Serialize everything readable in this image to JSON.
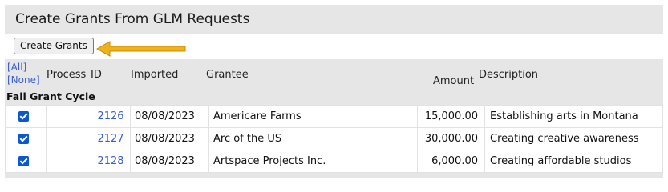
{
  "page": {
    "title": "Create Grants From GLM Requests"
  },
  "toolbar": {
    "create_label": "Create Grants"
  },
  "columns": {
    "all": "[All]",
    "none": "[None]",
    "process": "Process",
    "id": "ID",
    "imported": "Imported",
    "grantee": "Grantee",
    "amount": "Amount",
    "description": "Description"
  },
  "section": {
    "title": "Fall Grant Cycle"
  },
  "rows": [
    {
      "checked": true,
      "id": "2126",
      "imported": "08/08/2023",
      "grantee": "Americare Farms",
      "amount": "15,000.00",
      "description": "Establishing arts in Montana"
    },
    {
      "checked": true,
      "id": "2127",
      "imported": "08/08/2023",
      "grantee": "Arc of the US",
      "amount": "30,000.00",
      "description": "Creating creative awareness"
    },
    {
      "checked": true,
      "id": "2128",
      "imported": "08/08/2023",
      "grantee": "Artspace Projects Inc.",
      "amount": "6,000.00",
      "description": "Creating affordable studios"
    }
  ],
  "colors": {
    "header_bg": "#e6e6e6",
    "link": "#3a5fcd",
    "checkbox": "#0b57d0",
    "arrow": "#f0b21b"
  }
}
